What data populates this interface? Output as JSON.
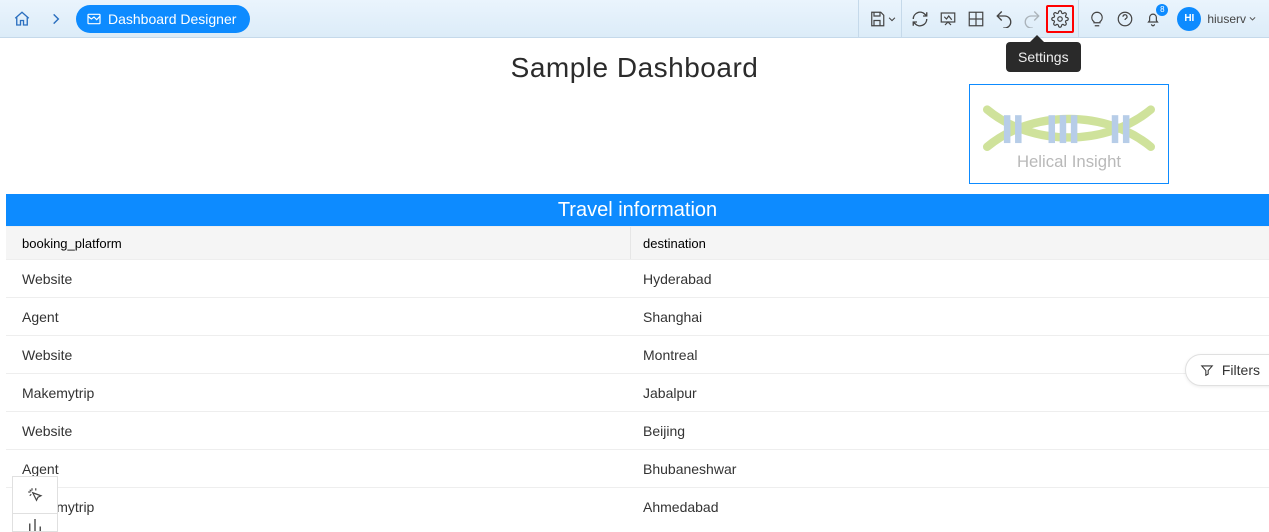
{
  "breadcrumb": {
    "label": "Dashboard Designer"
  },
  "topbar": {
    "notif_count": "8",
    "user_initials": "HI",
    "user_name": "hiuserv",
    "tooltip": "Settings"
  },
  "page": {
    "title": "Sample Dashboard"
  },
  "logo": {
    "text": "Helical Insight"
  },
  "table": {
    "section_title": "Travel information",
    "cols": {
      "c1": "booking_platform",
      "c2": "destination"
    },
    "rows": [
      {
        "c1": "Website",
        "c2": "Hyderabad"
      },
      {
        "c1": "Agent",
        "c2": "Shanghai"
      },
      {
        "c1": "Website",
        "c2": "Montreal"
      },
      {
        "c1": "Makemytrip",
        "c2": "Jabalpur"
      },
      {
        "c1": "Website",
        "c2": "Beijing"
      },
      {
        "c1": "Agent",
        "c2": "Bhubaneshwar"
      },
      {
        "c1": "Makemytrip",
        "c2": "Ahmedabad"
      }
    ]
  },
  "filters": {
    "label": "Filters"
  }
}
